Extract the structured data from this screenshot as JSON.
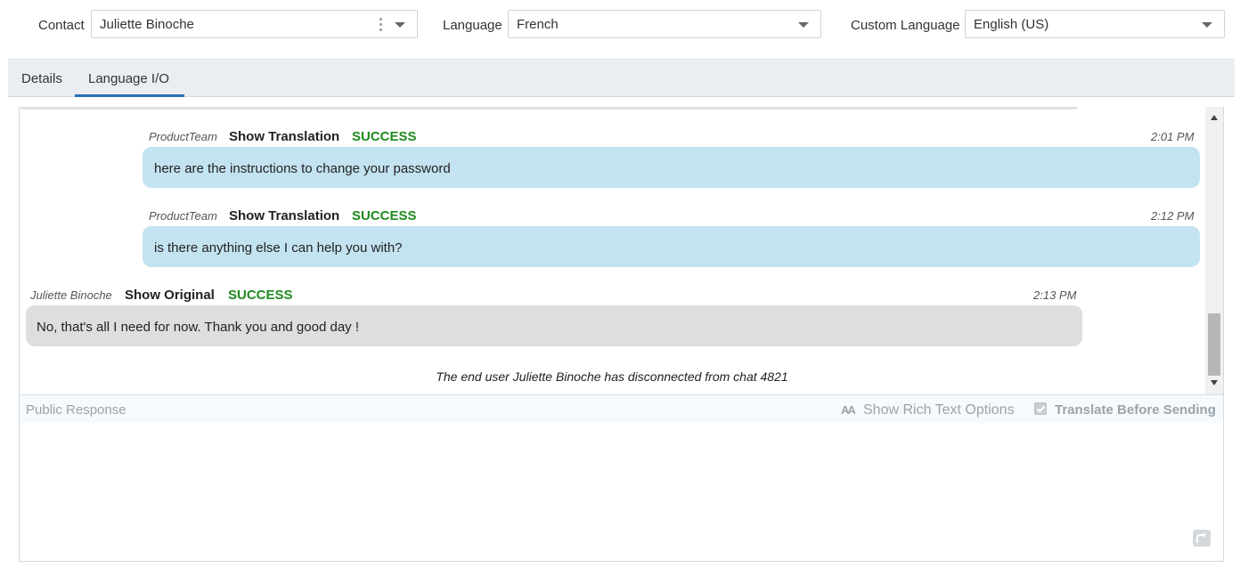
{
  "header": {
    "contact": {
      "label": "Contact",
      "value": "Juliette Binoche"
    },
    "language": {
      "label": "Language",
      "value": "French"
    },
    "custom_language": {
      "label": "Custom Language",
      "value": "English (US)"
    }
  },
  "tabs": [
    {
      "label": "Details",
      "active": false
    },
    {
      "label": "Language I/O",
      "active": true
    }
  ],
  "messages": [
    {
      "author": "ProductTeam",
      "action": "Show Translation",
      "status": "SUCCESS",
      "time": "2:01 PM",
      "text": "here are the instructions to change your password",
      "side": "agent"
    },
    {
      "author": "ProductTeam",
      "action": "Show Translation",
      "status": "SUCCESS",
      "time": "2:12 PM",
      "text": "is there anything else I can help you with?",
      "side": "agent"
    },
    {
      "author": "Juliette Binoche",
      "action": "Show Original",
      "status": "SUCCESS",
      "time": "2:13 PM",
      "text": "No, that's all I need for now. Thank you and good day !",
      "side": "customer"
    }
  ],
  "system_note": "The end user Juliette Binoche has disconnected from chat 4821",
  "composer": {
    "label": "Public Response",
    "rich_text_icon": "AA",
    "rich_text_label": "Show Rich Text Options",
    "translate_label": "Translate Before Sending",
    "translate_checked": true,
    "value": ""
  },
  "colors": {
    "success": "#1e8a1e",
    "agent_bubble": "#c3e3f1",
    "customer_bubble": "#dedede",
    "tab_accent": "#2770b5"
  }
}
